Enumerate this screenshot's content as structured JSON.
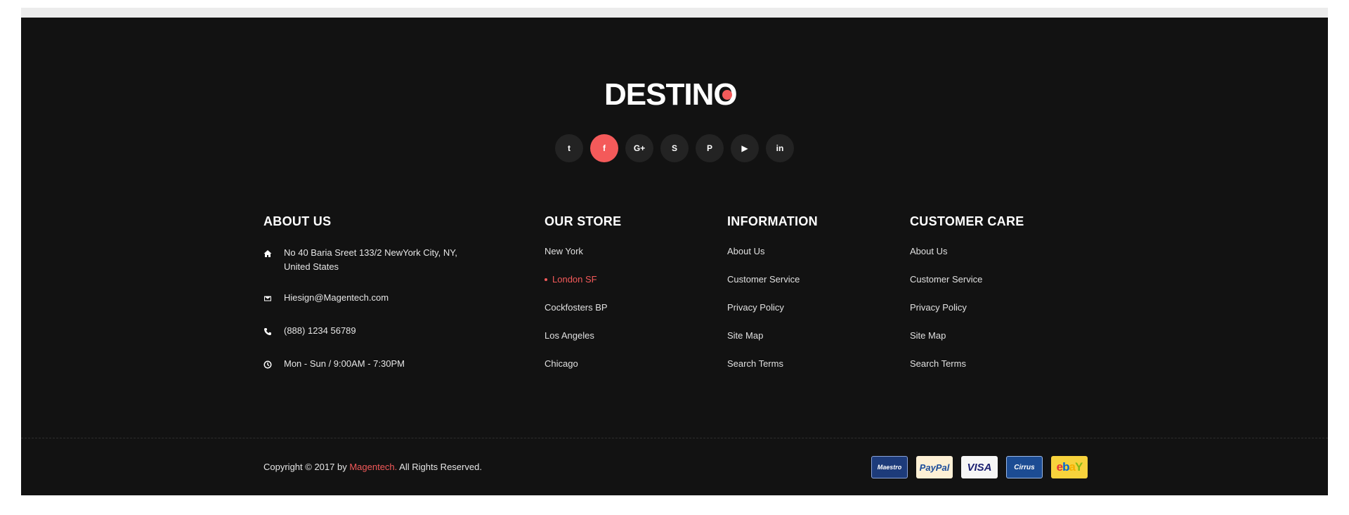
{
  "logo": {
    "text": "DESTINO"
  },
  "social": [
    {
      "name": "twitter",
      "icon": "twitter-icon",
      "glyph": "t"
    },
    {
      "name": "facebook",
      "icon": "facebook-icon",
      "glyph": "f",
      "active": true
    },
    {
      "name": "google-plus",
      "icon": "google-plus-icon",
      "glyph": "G+"
    },
    {
      "name": "skype",
      "icon": "skype-icon",
      "glyph": "S"
    },
    {
      "name": "pinterest",
      "icon": "pinterest-icon",
      "glyph": "P"
    },
    {
      "name": "youtube",
      "icon": "youtube-icon",
      "glyph": "▶"
    },
    {
      "name": "linkedin",
      "icon": "linkedin-icon",
      "glyph": "in"
    }
  ],
  "about": {
    "title": "ABOUT US",
    "address": "No 40 Baria Sreet 133/2 NewYork City, NY, United States",
    "email": "Hiesign@Magentech.com",
    "phone": "(888) 1234 56789",
    "hours": "Mon - Sun / 9:00AM - 7:30PM"
  },
  "store": {
    "title": "OUR STORE",
    "items": [
      "New York",
      "London SF",
      "Cockfosters BP",
      "Los Angeles",
      "Chicago"
    ],
    "active_index": 1
  },
  "information": {
    "title": "INFORMATION",
    "items": [
      "About Us",
      "Customer Service",
      "Privacy Policy",
      "Site Map",
      "Search Terms"
    ]
  },
  "care": {
    "title": "CUSTOMER CARE",
    "items": [
      "About Us",
      "Customer Service",
      "Privacy Policy",
      "Site Map",
      "Search Terms"
    ]
  },
  "copyright": {
    "prefix": "Copyright © 2017 by ",
    "brand": "Magentech.",
    "suffix": " All Rights Reserved."
  },
  "payments": {
    "maestro": "Maestro",
    "paypal": "PayPal",
    "visa": "VISA",
    "cirrus": "Cirrus",
    "ebay": [
      "e",
      "b",
      "a",
      "Y"
    ]
  },
  "colors": {
    "footer_bg": "#121212",
    "accent": "#f45a5a",
    "text": "#e6e6e6"
  }
}
